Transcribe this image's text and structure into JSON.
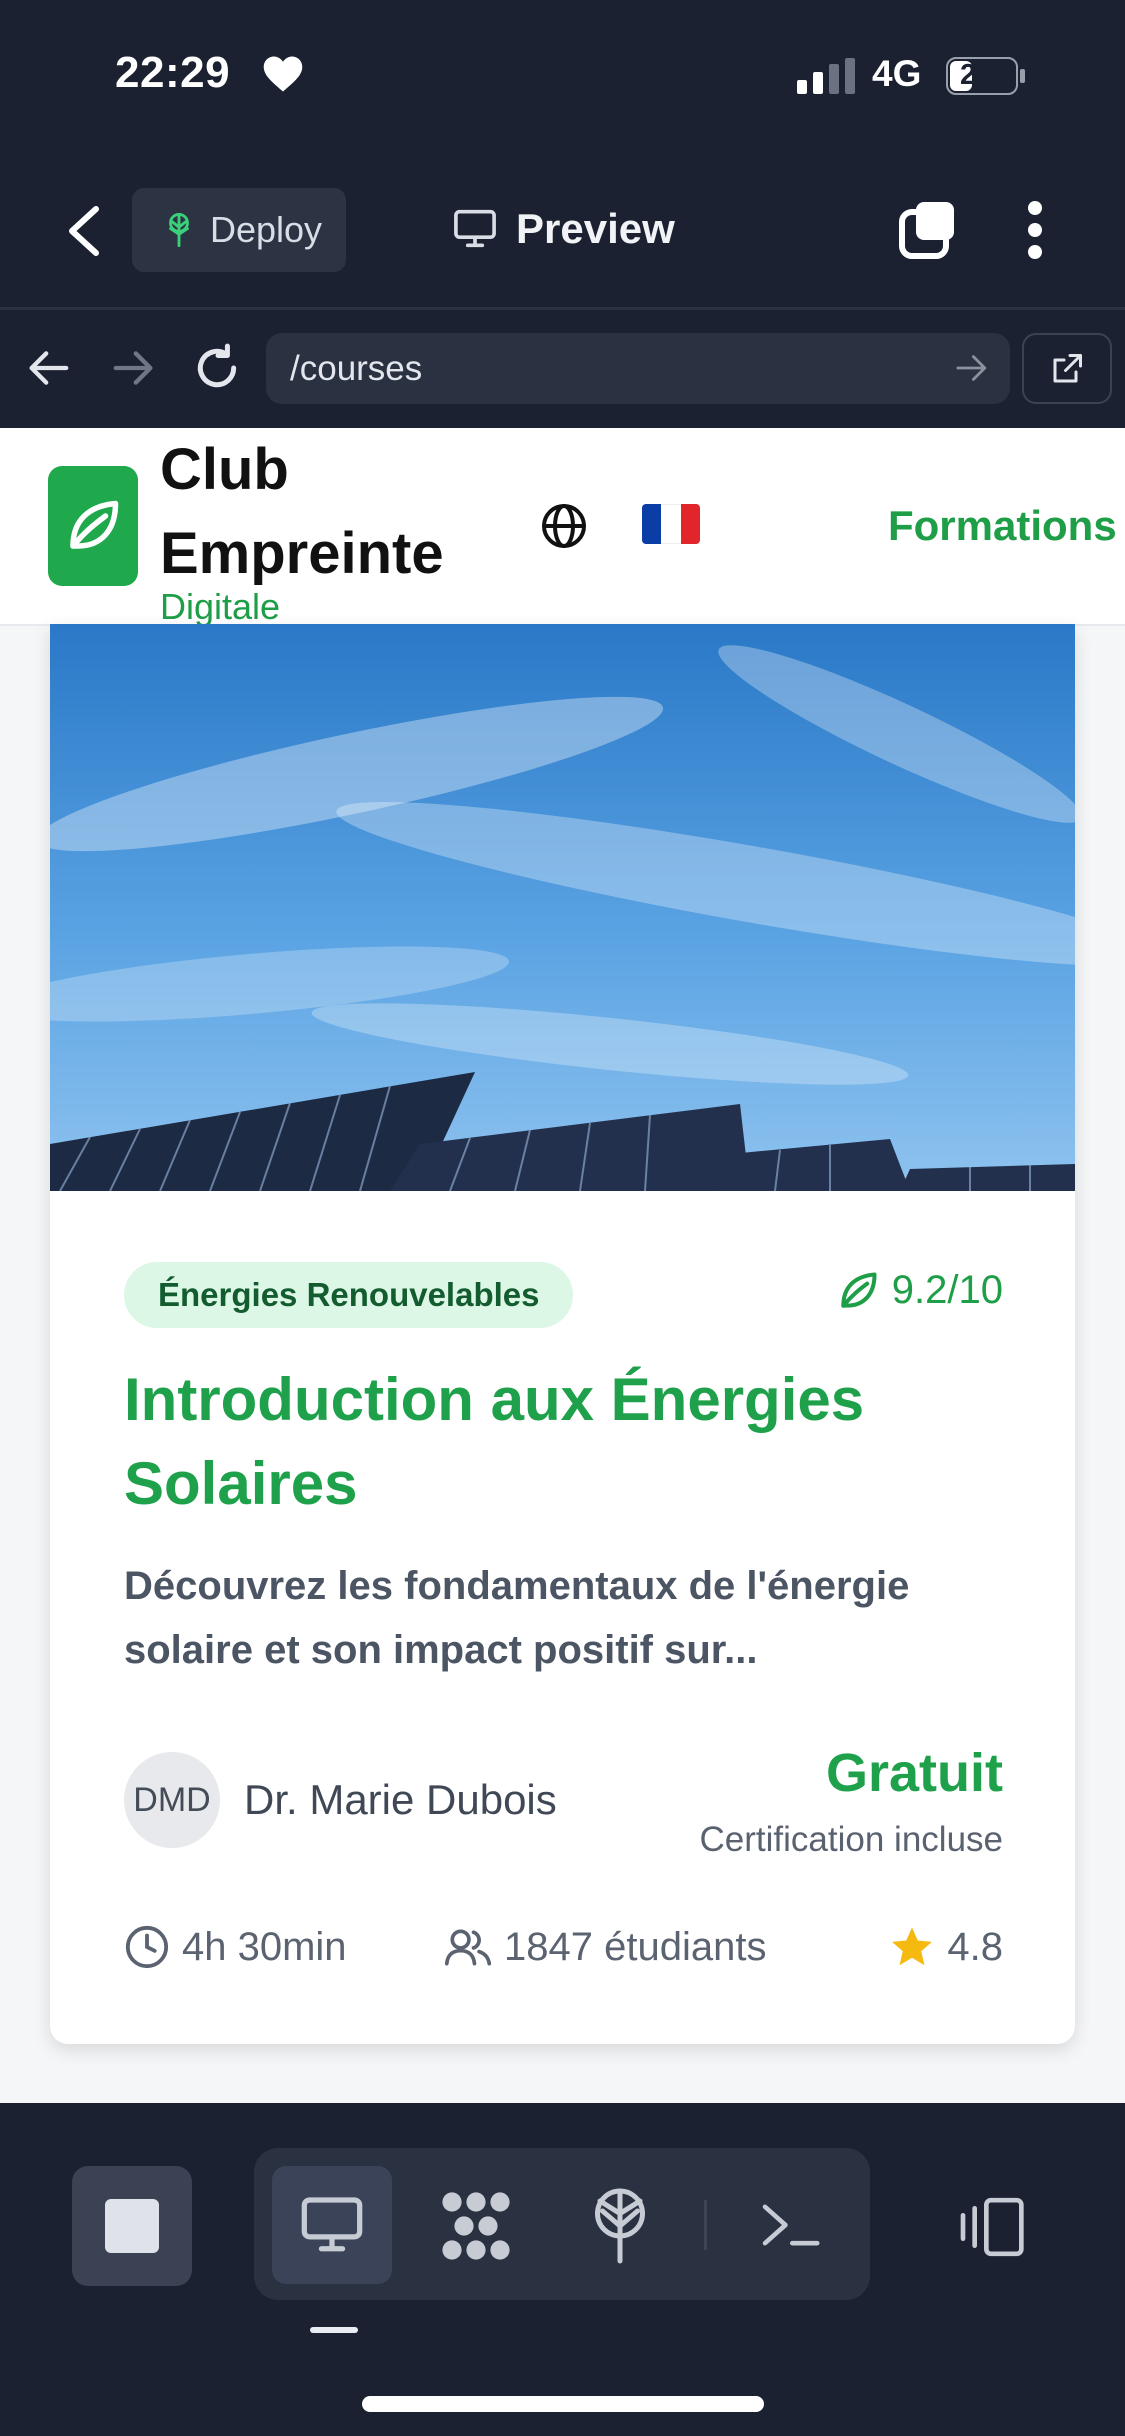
{
  "status": {
    "time": "22:29",
    "network": "4G",
    "battery": "25"
  },
  "app_header": {
    "deploy_label": "Deploy",
    "preview_label": "Preview"
  },
  "browser": {
    "url": "/courses"
  },
  "site": {
    "brand_line1": "Club",
    "brand_line2": "Empreinte",
    "brand_line3": "Digitale",
    "nav_link": "Formations",
    "flag_colors": [
      "#0a3ea6",
      "#ffffff",
      "#e1252b"
    ]
  },
  "course": {
    "category": "Énergies Renouvelables",
    "score": "9.2/10",
    "title": "Introduction aux Énergies Solaires",
    "description": "Découvrez les fondamentaux de l'énergie solaire et son impact positif sur...",
    "author_initials": "DMD",
    "author_name": "Dr. Marie Dubois",
    "price": "Gratuit",
    "certification": "Certification incluse",
    "duration": "4h 30min",
    "students": "1847 étudiants",
    "rating": "4.8"
  },
  "colors": {
    "accent_green": "#1ea14a",
    "dark_bg": "#1b2130",
    "star": "#f5b90f"
  }
}
